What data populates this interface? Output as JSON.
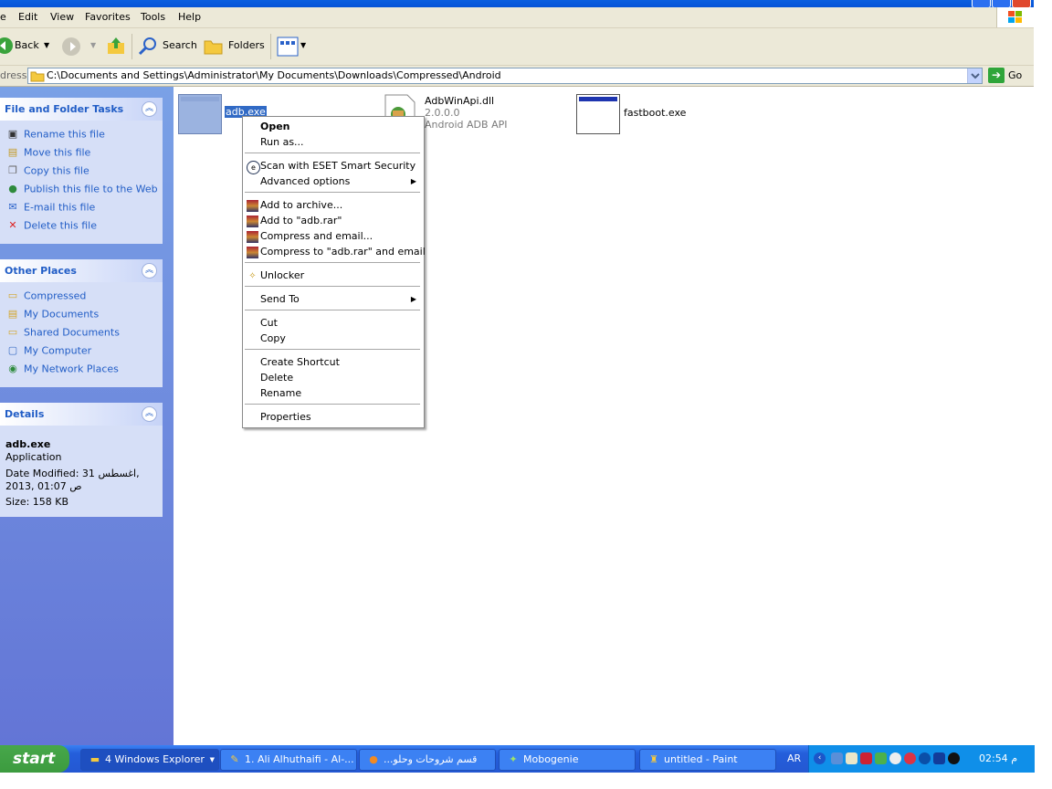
{
  "menubar": {
    "items": [
      "e",
      "Edit",
      "View",
      "Favorites",
      "Tools",
      "Help"
    ]
  },
  "toolbar": {
    "back": "Back",
    "search": "Search",
    "folders": "Folders"
  },
  "address": {
    "label": "dress",
    "path": "C:\\Documents and Settings\\Administrator\\My Documents\\Downloads\\Compressed\\Android",
    "go": "Go"
  },
  "file_tasks": {
    "title": "File and Folder Tasks",
    "items": [
      "Rename this file",
      "Move this file",
      "Copy this file",
      "Publish this file to the Web",
      "E-mail this file",
      "Delete this file"
    ]
  },
  "other_places": {
    "title": "Other Places",
    "items": [
      "Compressed",
      "My Documents",
      "Shared Documents",
      "My Computer",
      "My Network Places"
    ]
  },
  "details": {
    "title": "Details",
    "name": "adb.exe",
    "type": "Application",
    "modified_line1": "Date Modified: 31 اغسطس,",
    "modified_line2": "2013, 01:07 ص",
    "size": "Size: 158 KB"
  },
  "files": [
    {
      "name": "adb.exe"
    },
    {
      "name": "AdbWinApi.dll",
      "version": "2.0.0.0",
      "desc": "Android ADB API"
    },
    {
      "name": "fastboot.exe"
    }
  ],
  "context_menu": {
    "open": "Open",
    "run_as": "Run as...",
    "scan": "Scan with ESET Smart Security",
    "advanced": "Advanced options",
    "add_archive": "Add to archive...",
    "add_rar": "Add to \"adb.rar\"",
    "compress_email": "Compress and email...",
    "compress_rar_email": "Compress to \"adb.rar\" and email",
    "unlocker": "Unlocker",
    "send_to": "Send To",
    "cut": "Cut",
    "copy": "Copy",
    "create_shortcut": "Create Shortcut",
    "delete": "Delete",
    "rename": "Rename",
    "properties": "Properties"
  },
  "taskbar": {
    "start": "start",
    "tasks": [
      "4 Windows Explorer",
      "1. Ali Alhuthaifi - Al-...",
      "...قسم شروحات وحلو",
      "Mobogenie",
      "untitled - Paint"
    ],
    "lang": "AR",
    "clock": "02:54 م"
  },
  "colors": {
    "accent": "#215dc6",
    "taskbar": "#245edb",
    "start": "#3c9b3f",
    "tray": "#0f8fe9"
  }
}
